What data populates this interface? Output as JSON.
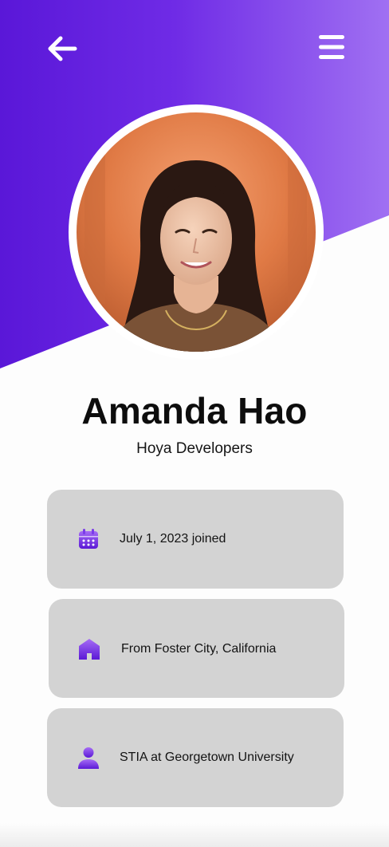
{
  "header": {
    "back_icon": "arrow-left-icon",
    "menu_icon": "hamburger-menu-icon",
    "gradient_colors": [
      "#5a17d8",
      "#a070f2"
    ]
  },
  "profile": {
    "name": "Amanda Hao",
    "organization": "Hoya Developers",
    "avatar": "profile-photo"
  },
  "info_cards": [
    {
      "icon": "calendar-icon",
      "text": "July 1, 2023 joined"
    },
    {
      "icon": "home-icon",
      "text": "From Foster City, California"
    },
    {
      "icon": "person-icon",
      "text": "STIA at Georgetown University"
    }
  ],
  "colors": {
    "accent": "#6d28e0",
    "card_background": "#d3d3d3",
    "page_background": "#fdfdfd"
  }
}
